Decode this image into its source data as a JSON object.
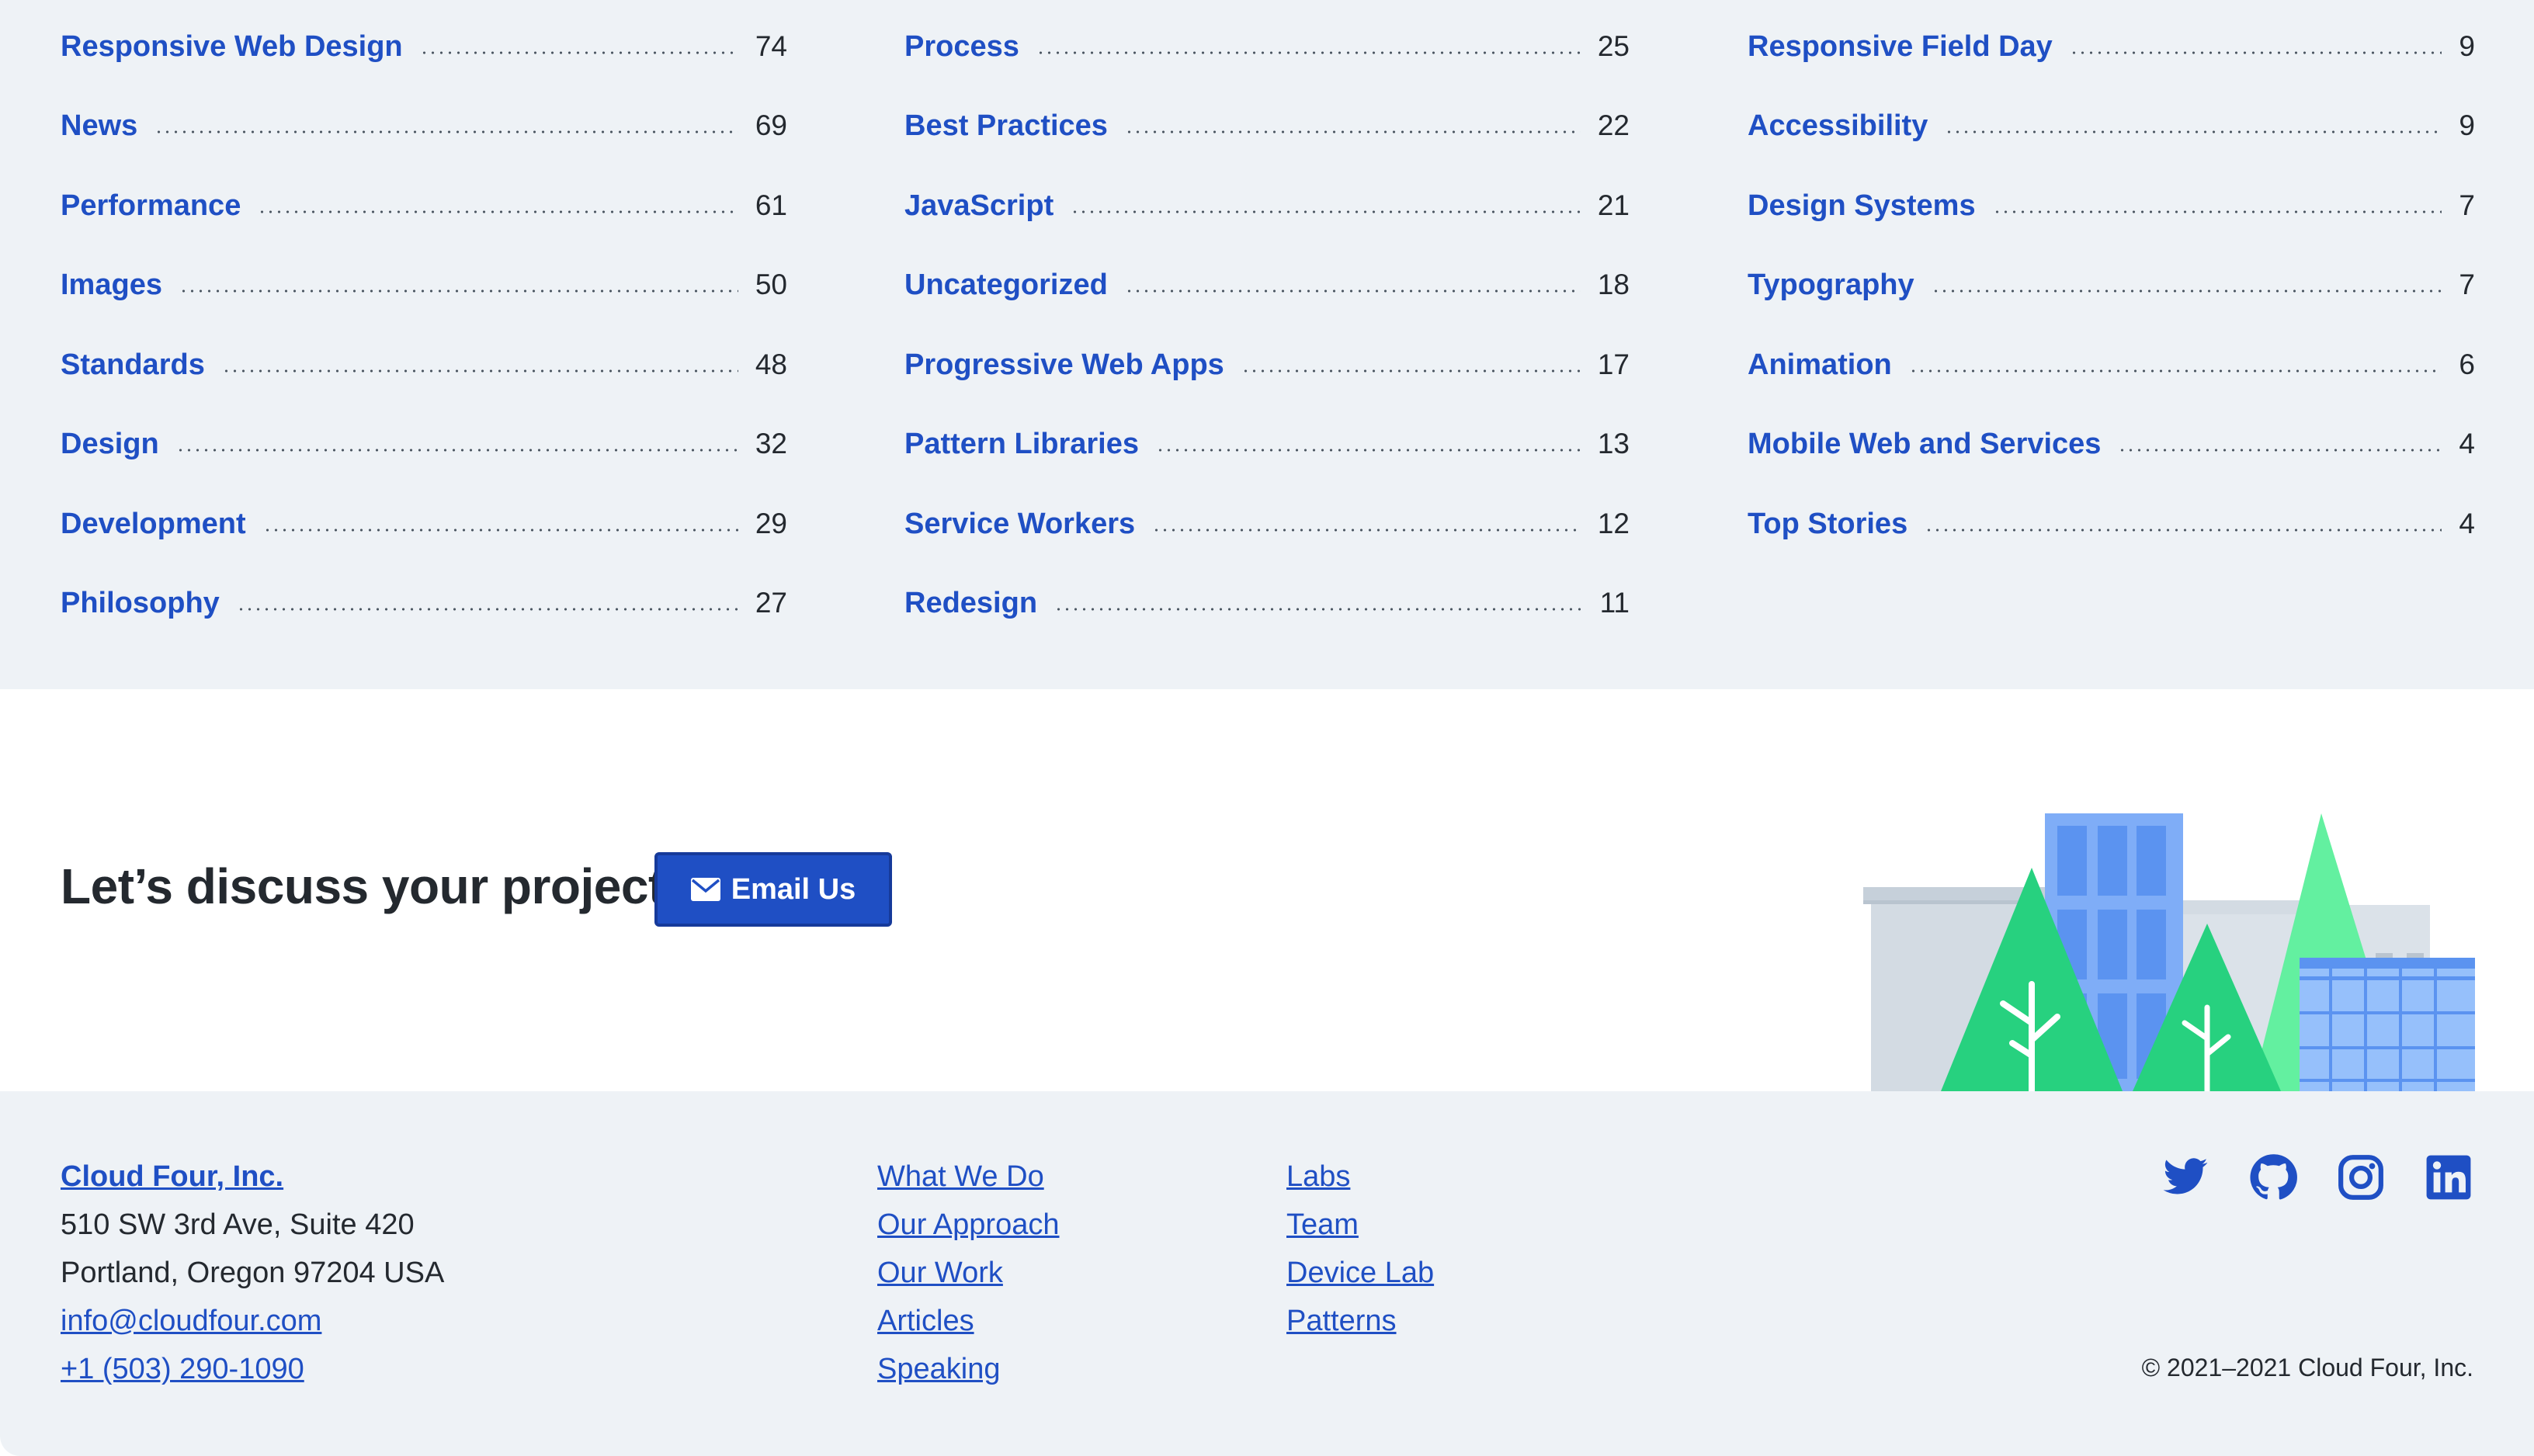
{
  "topics": {
    "columns": [
      [
        {
          "name": "Responsive Web Design",
          "count": "74"
        },
        {
          "name": "News",
          "count": "69"
        },
        {
          "name": "Performance",
          "count": "61"
        },
        {
          "name": "Images",
          "count": "50"
        },
        {
          "name": "Standards",
          "count": "48"
        },
        {
          "name": "Design",
          "count": "32"
        },
        {
          "name": "Development",
          "count": "29"
        },
        {
          "name": "Philosophy",
          "count": "27"
        }
      ],
      [
        {
          "name": "Process",
          "count": "25"
        },
        {
          "name": "Best Practices",
          "count": "22"
        },
        {
          "name": "JavaScript",
          "count": "21"
        },
        {
          "name": "Uncategorized",
          "count": "18"
        },
        {
          "name": "Progressive Web Apps",
          "count": "17"
        },
        {
          "name": "Pattern Libraries",
          "count": "13"
        },
        {
          "name": "Service Workers",
          "count": "12"
        },
        {
          "name": "Redesign",
          "count": "11"
        }
      ],
      [
        {
          "name": "Responsive Field Day",
          "count": "9"
        },
        {
          "name": "Accessibility",
          "count": "9"
        },
        {
          "name": "Design Systems",
          "count": "7"
        },
        {
          "name": "Typography",
          "count": "7"
        },
        {
          "name": "Animation",
          "count": "6"
        },
        {
          "name": "Mobile Web and Services",
          "count": "4"
        },
        {
          "name": "Top Stories",
          "count": "4"
        }
      ]
    ]
  },
  "cta": {
    "heading": "Let’s discuss your project!",
    "button_label": "Email Us",
    "button_icon": "envelope-icon"
  },
  "footer": {
    "company": "Cloud Four, Inc.",
    "address_line1": "510 SW 3rd Ave, Suite 420",
    "address_line2": "Portland, Oregon 97204 USA",
    "email": "info@cloudfour.com",
    "phone": "+1 (503) 290-1090",
    "nav_col1": [
      "What We Do",
      "Our Approach",
      "Our Work",
      "Articles",
      "Speaking"
    ],
    "nav_col2": [
      "Labs",
      "Team",
      "Device Lab",
      "Patterns"
    ],
    "social": [
      "twitter-icon",
      "github-icon",
      "instagram-icon",
      "linkedin-icon"
    ],
    "copyright": "© 2021–2021 Cloud Four, Inc."
  },
  "colors": {
    "link": "#1f4fc4",
    "section_bg": "#eef2f6",
    "text": "#24292f",
    "tree_green": "#27d17f",
    "tree_light_green": "#63f0a0",
    "building_blue": "#7fadf7",
    "building_gray": "#d3dbe3"
  }
}
